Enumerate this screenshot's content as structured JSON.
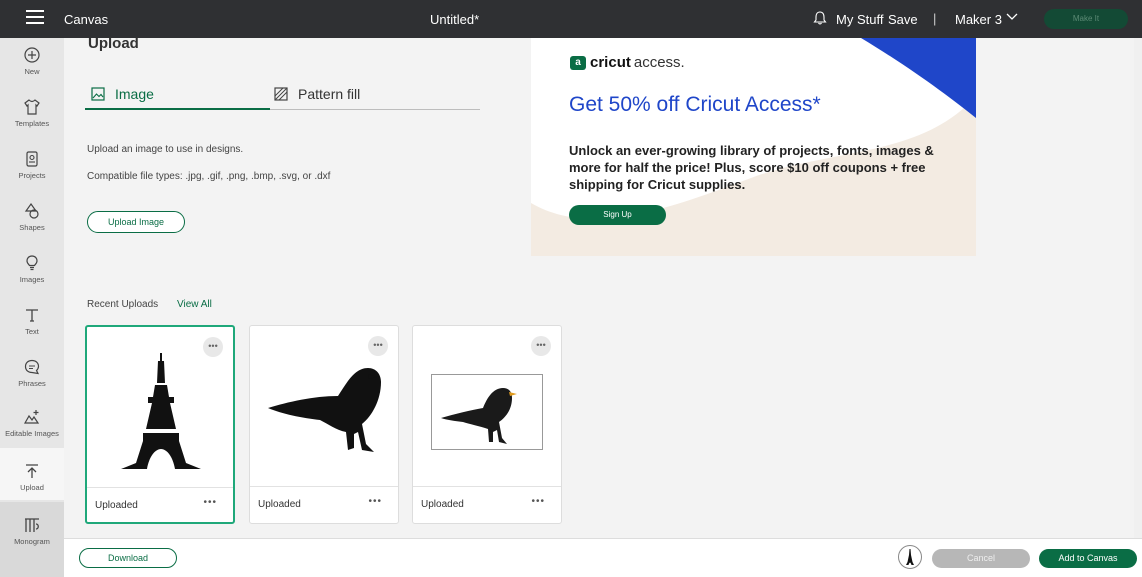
{
  "topbar": {
    "app_name": "Canvas",
    "doc_title": "Untitled*",
    "my_stuff": "My Stuff",
    "save": "Save",
    "separator": "|",
    "machine": "Maker 3",
    "make_it": "Make It"
  },
  "sidebar": {
    "items": [
      {
        "label": "New",
        "icon": "plus-circle-icon"
      },
      {
        "label": "Templates",
        "icon": "shirt-icon"
      },
      {
        "label": "Projects",
        "icon": "projects-icon"
      },
      {
        "label": "Shapes",
        "icon": "shapes-icon"
      },
      {
        "label": "Images",
        "icon": "lightbulb-icon"
      },
      {
        "label": "Text",
        "icon": "text-icon"
      },
      {
        "label": "Phrases",
        "icon": "speech-bubble-icon"
      },
      {
        "label": "Editable Images",
        "icon": "editable-images-icon"
      },
      {
        "label": "Upload",
        "icon": "upload-icon"
      },
      {
        "label": "Monogram",
        "icon": "monogram-icon"
      }
    ]
  },
  "upload_panel": {
    "heading": "Upload",
    "tabs": [
      {
        "label": "Image",
        "active": true
      },
      {
        "label": "Pattern fill",
        "active": false
      }
    ],
    "description": "Upload an image to use in designs.",
    "file_types": "Compatible file types: .jpg, .gif, .png, .bmp, .svg, or .dxf",
    "upload_button": "Upload Image",
    "recent_label": "Recent Uploads",
    "view_all": "View All",
    "uploads": [
      {
        "label": "Uploaded",
        "image": "eiffel-tower",
        "selected": true
      },
      {
        "label": "Uploaded",
        "image": "bird-silhouette",
        "selected": false
      },
      {
        "label": "Uploaded",
        "image": "blackbird-photo",
        "selected": false
      }
    ]
  },
  "ad": {
    "brand_badge": "a",
    "brand": "cricut",
    "brand_suffix": "access.",
    "headline": "Get 50% off Cricut Access*",
    "body": "Unlock an ever-growing library of projects, fonts, images & more for half the price! Plus, score $10 off coupons + free shipping for Cricut supplies.",
    "cta": "Sign Up",
    "accent_color": "#1f46c9"
  },
  "footer": {
    "download": "Download",
    "cancel": "Cancel",
    "add_to_canvas": "Add to Canvas"
  },
  "colors": {
    "brand_green": "#0a6d45",
    "topbar": "#2f3033"
  }
}
